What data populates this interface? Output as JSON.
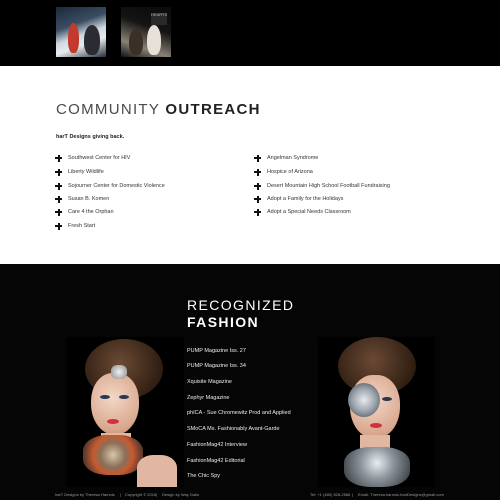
{
  "gallery_top": {
    "thumbnails": [
      {
        "name": "event-photo-1"
      },
      {
        "name": "event-photo-2",
        "sign_text": "HEARTS"
      }
    ]
  },
  "community": {
    "heading_thin": "COMMUNITY ",
    "heading_bold": "OUTREACH",
    "intro": "harT Designs giving back.",
    "left_items": [
      "Southwest Center for HIV",
      "Liberty Wildlife",
      "Sojourner Center for Domestic Violence",
      "Susan B. Komen",
      "Care 4 the Orphan",
      "Fresh Start"
    ],
    "right_items": [
      "Angelman Syndrome",
      "Hospice of Arizona",
      "Desert Mountain High School Football Fundraising",
      "Adopt a Family for the Holidays",
      "Adopt a Special Needs Classroom"
    ]
  },
  "fashion": {
    "heading_line1": "RECOGNIZED",
    "heading_line2": "FASHION",
    "press": [
      "PUMP Magazine Iss. 27",
      "PUMP Magazine Iss. 34",
      "Xquisite Magazine",
      "Zephyr Magazine",
      "phICA - Sue Chromewitz Prod and Applied",
      "SMoCA Ms. Fashionably Avant-Garde",
      "FashionMag42 Interview",
      "FashionMag42 Editorial",
      "The Chic Spy"
    ]
  },
  "footer": {
    "credit": "harT Designs by Theresa Harnois",
    "copyright": "Copyright © 2016",
    "design": "Design by Way Gallo",
    "phone": "Tel: +1 (480) 828-2586",
    "email": "Email: Theresa.harnois.hartDesigns@gmail.com",
    "separator": "|"
  }
}
